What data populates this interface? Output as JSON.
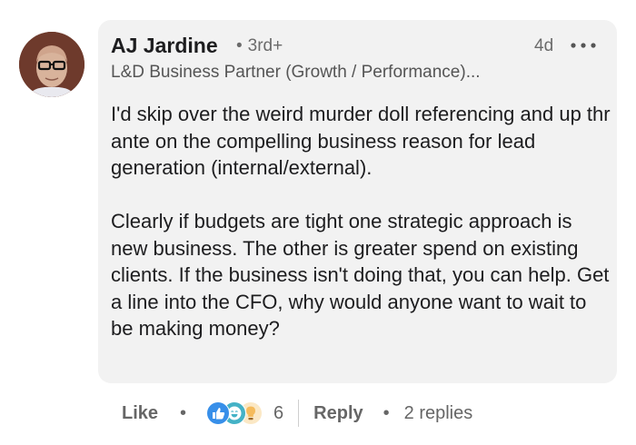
{
  "comment": {
    "author_name": "AJ Jardine",
    "connection_degree": "3rd+",
    "timestamp": "4d",
    "headline": "L&D Business Partner (Growth / Performance)...",
    "paragraphs": [
      "I'd skip over the weird murder doll referencing and up thr ante on the compelling business reason for lead generation (internal/external).",
      "Clearly if budgets are tight one strategic approach is new business. The other is greater spend on existing clients. If the business isn't doing that, you can help. Get a line into the CFO, why would anyone want to wait to be making money?"
    ],
    "more_icon": "ellipsis-icon"
  },
  "actions": {
    "like_label": "Like",
    "separator": "•",
    "reaction_icons": [
      "like-reaction-icon",
      "funny-reaction-icon",
      "insightful-reaction-icon"
    ],
    "reaction_count": "6",
    "reply_label": "Reply",
    "replies_label": "2 replies"
  },
  "colors": {
    "bubble": "#f2f2f2",
    "like_blue": "#378fe9",
    "funny_teal": "#44b2c6",
    "insight_yellow": "#f5bb5c"
  }
}
